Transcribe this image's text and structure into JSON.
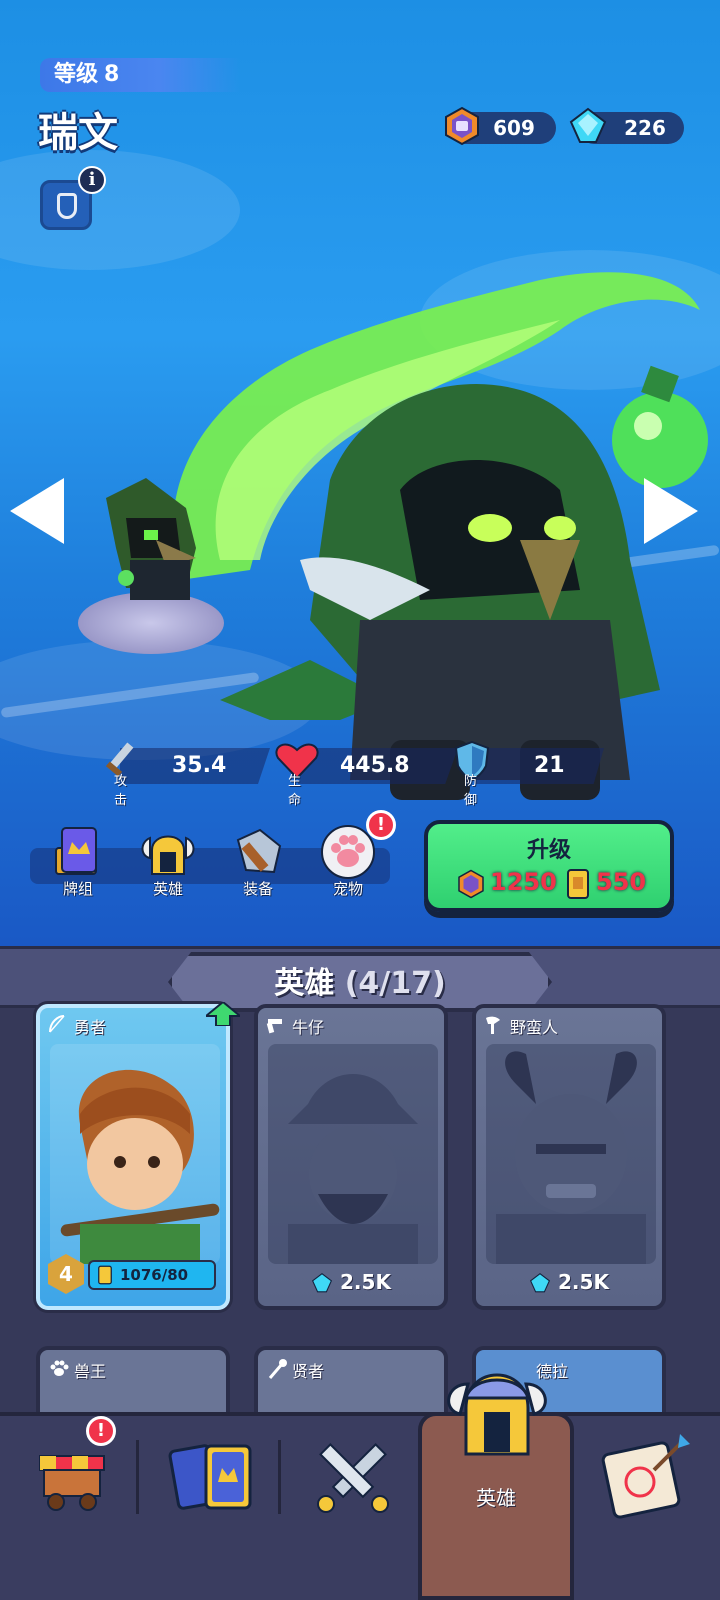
{
  "header": {
    "level_label": "等级",
    "level_value": "8",
    "hero_name": "瑞文",
    "info_icon": "i"
  },
  "currency": {
    "coins": "609",
    "gems": "226"
  },
  "stats": {
    "attack_label": "攻击",
    "attack_value": "35.4",
    "hp_label": "生命",
    "hp_value": "445.8",
    "defense_label": "防御",
    "defense_value": "21"
  },
  "menu": {
    "deck": "牌组",
    "hero": "英雄",
    "equipment": "装备",
    "pet": "宠物",
    "pet_alert": "!"
  },
  "upgrade": {
    "title": "升级",
    "coin_cost": "1250",
    "card_cost": "550"
  },
  "panel": {
    "title": "英雄",
    "count": "(4/17)"
  },
  "cards": [
    {
      "name": "勇者",
      "level": "4",
      "progress": "1076/80"
    },
    {
      "name": "牛仔",
      "price": "2.5K"
    },
    {
      "name": "野蛮人",
      "price": "2.5K"
    }
  ],
  "cards_row2": [
    {
      "name": "兽王"
    },
    {
      "name": "贤者"
    },
    {
      "name": "德拉"
    }
  ],
  "bottom_nav": {
    "shop_alert": "!",
    "hero_label": "英雄"
  },
  "colors": {
    "sky": "#2a9cf0",
    "upgrade_green": "#2fd070",
    "cost_red": "#f0334a",
    "panel_bg": "#363959",
    "active_tab": "#8c5a50"
  }
}
